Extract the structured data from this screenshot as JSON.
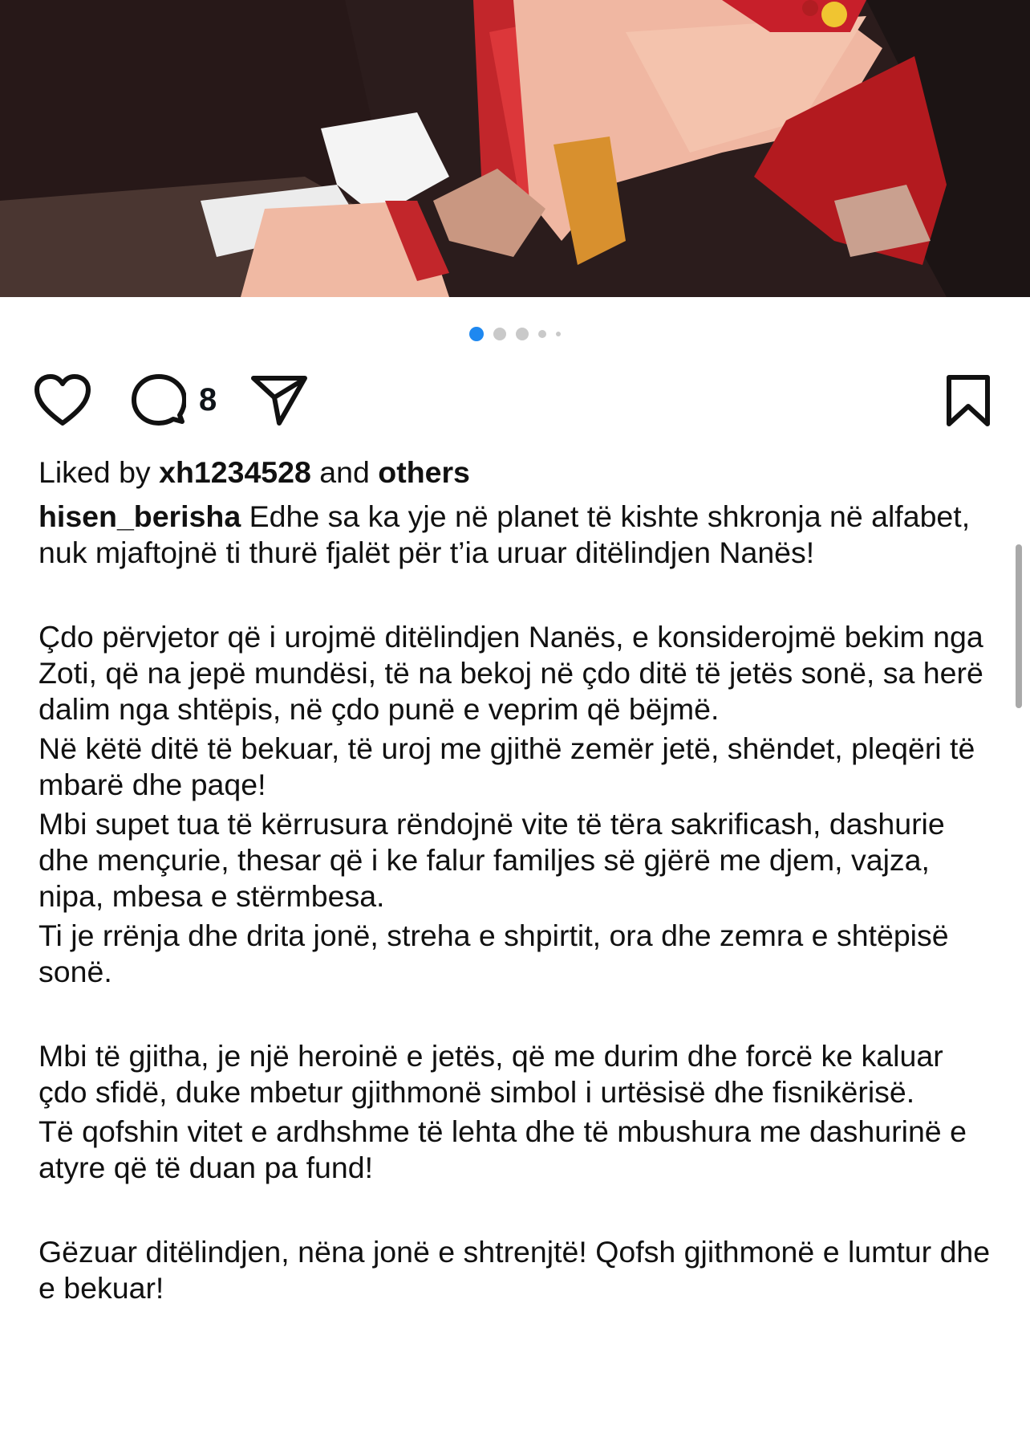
{
  "post": {
    "image_alt": "photo-flowers-bouquet",
    "carousel_count": 5,
    "carousel_active_index": 0,
    "comment_count": "8",
    "liked_by": {
      "prefix": "Liked by",
      "user": "xh1234528",
      "connector": "and",
      "others": "others"
    },
    "caption": {
      "username": "hisen_berisha",
      "first_line": "Edhe sa ka yje në planet të kishte shkronja në alfabet, nuk mjaftojnë ti thurë fjalët për t’ia uruar ditëlindjen Nanës!",
      "paragraphs": [
        "Çdo përvjetor që i urojmë ditëlindjen Nanës, e konsiderojmë bekim nga Zoti, që na jepë mundësi, të na bekoj në çdo ditë të jetës sonë, sa herë dalim nga shtëpis, në çdo punë e veprim që bëjmë.",
        "Në këtë ditë të bekuar, të uroj me gjithë zemër jetë, shëndet, pleqëri të mbarë dhe paqe!",
        "Mbi supet tua të kërrusura rëndojnë vite të tëra sakrificash, dashurie dhe mençurie, thesar që i ke falur familjes së gjërë me djem, vajza, nipa, mbesa e stërmbesa.",
        "Ti je rrënja dhe drita jonë, streha e shpirtit, ora dhe zemra e shtëpisë sonë.",
        "Mbi të gjitha, je një heroinë e jetës, që me durim dhe forcë ke kaluar çdo sfidë, duke mbetur gjithmonë simbol i urtësisë dhe fisnikërisë.",
        "Të qofshin vitet e ardhshme të lehta dhe të mbushura me dashurinë e atyre që të duan pa fund!",
        "Gëzuar ditëlindjen, nëna jonë e shtrenjtë! Qofsh gjithmonë e lumtur dhe e bekuar!"
      ]
    }
  },
  "icons": {
    "like": "heart-outline-icon",
    "comment": "comment-bubble-icon",
    "share": "paper-plane-icon",
    "save": "bookmark-outline-icon"
  },
  "colors": {
    "carousel_active": "#1e88f0",
    "carousel_inactive": "#c9c9c9",
    "text": "#111111"
  }
}
